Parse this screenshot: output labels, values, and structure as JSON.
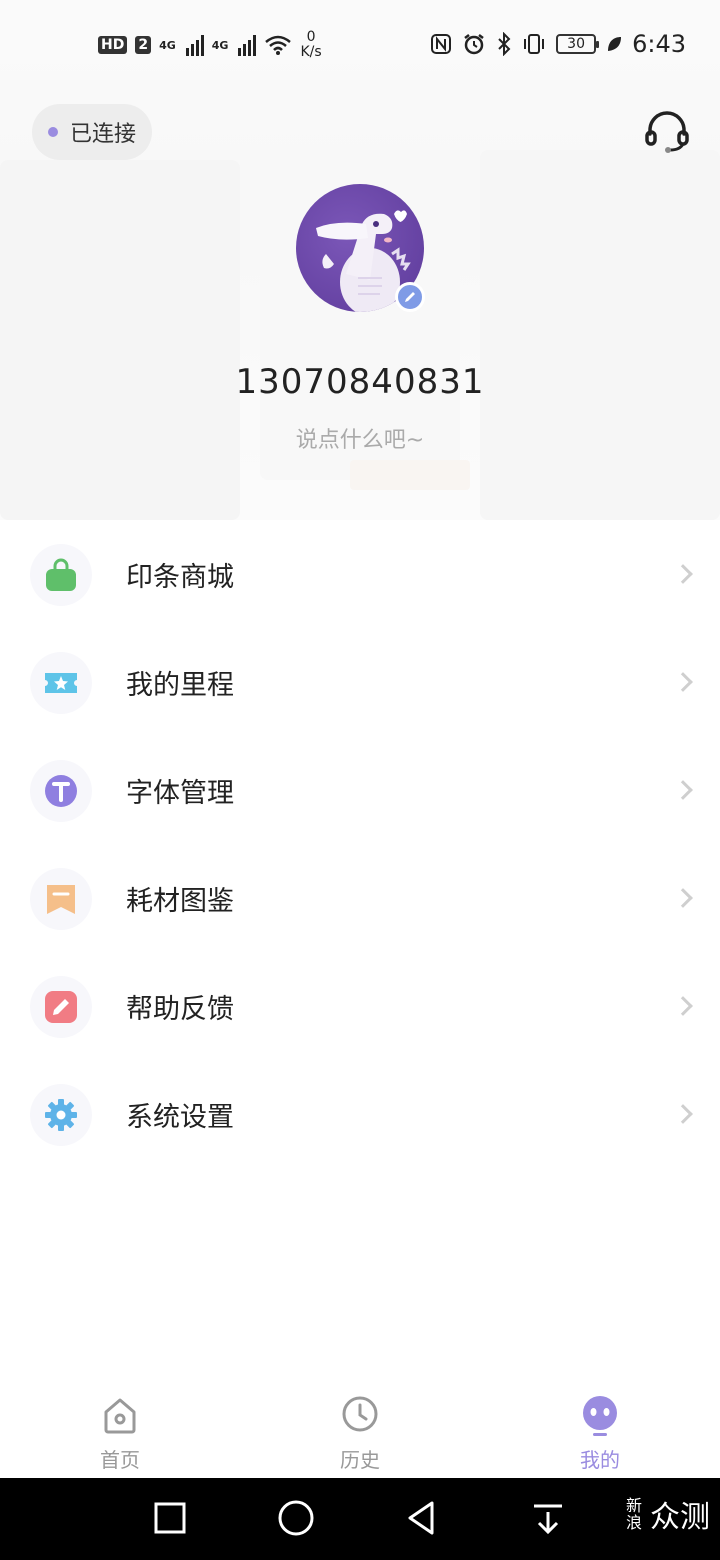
{
  "status_bar": {
    "hd_label": "HD",
    "sim_label": "2",
    "net1": "4G",
    "net2": "4G",
    "speed_value": "0",
    "speed_unit": "K/s",
    "battery": "30",
    "time": "6:43"
  },
  "header": {
    "connection_label": "已连接",
    "phone": "13070840831",
    "motto": "说点什么吧~"
  },
  "menu": {
    "items": [
      {
        "label": "印条商城",
        "icon": "shopping-bag-icon",
        "color": "#5fbf6a"
      },
      {
        "label": "我的里程",
        "icon": "ticket-icon",
        "color": "#5ec4e8"
      },
      {
        "label": "字体管理",
        "icon": "font-icon",
        "color": "#8f7fe0"
      },
      {
        "label": "耗材图鉴",
        "icon": "bookmark-icon",
        "color": "#f5bf8a"
      },
      {
        "label": "帮助反馈",
        "icon": "edit-icon",
        "color": "#f17c84"
      },
      {
        "label": "系统设置",
        "icon": "gear-icon",
        "color": "#5eb3e8"
      }
    ]
  },
  "tabs": {
    "home": "首页",
    "history": "历史",
    "mine": "我的",
    "active_color": "#9a8ce0"
  },
  "watermark": {
    "small": "新浪",
    "large": "众测"
  }
}
